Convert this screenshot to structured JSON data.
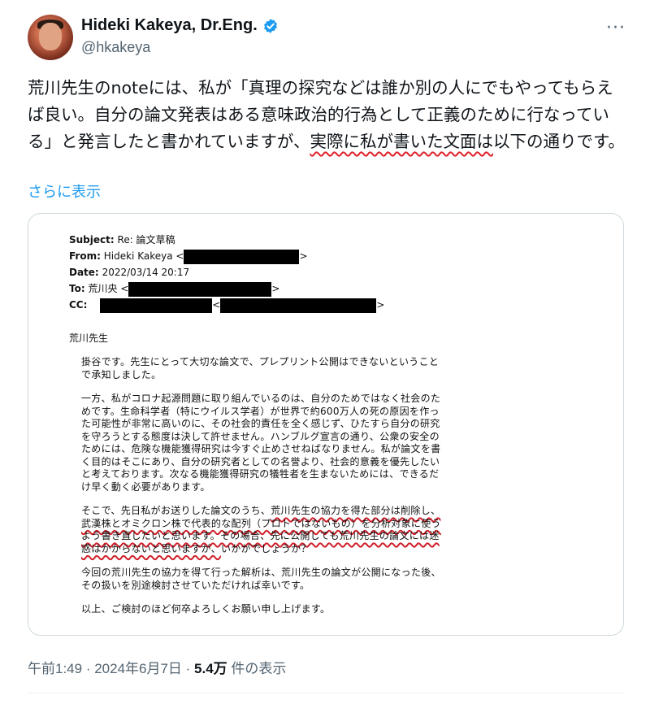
{
  "author": {
    "display_name": "Hideki Kakeya, Dr.Eng.",
    "handle": "@hkakeya",
    "verified_icon": "verified-badge-icon",
    "verified_color": "#1d9bf0"
  },
  "more_icon": "more-options-icon",
  "tweet": {
    "text_part1": "荒川先生のnoteには、私が「真理の探究などは誰か別の人にでもやってもらえば良い。自分の論文発表はある意味政治的行為として正義のために行なっている」と発言したと書かれていますが、",
    "text_underlined": "実際に私が書いた文面は",
    "text_part2": "以下の通りです。",
    "show_more": "さらに表示"
  },
  "email": {
    "subject_label": "Subject:",
    "subject": "Re: 論文草稿",
    "from_label": "From:",
    "from": "Hideki Kakeya <",
    "from_end": ">",
    "date_label": "Date:",
    "date": "2022/03/14 20:17",
    "to_label": "To:",
    "to": "荒川央 <",
    "to_end": ">",
    "cc_label": "CC:",
    "cc_mid": "<",
    "cc_end": ">",
    "greeting": "荒川先生",
    "p1": "掛谷です。先生にとって大切な論文で、プレプリント公開はできないということで承知しました。",
    "p2": "一方、私がコロナ起源問題に取り組んでいるのは、自分のためではなく社会のためです。生命科学者（特にウイルス学者）が世界で約600万人の死の原因を作った可能性が非常に高いのに、その社会的責任を全く感じず、ひたすら自分の研究を守ろうとする態度は決して許せません。ハンブルグ宣言の通り、公衆の安全のためには、危険な機能獲得研究は今すぐ止めさせねばなりません。私が論文を書く目的はそこにあり、自分の研究者としての名誉より、社会的意義を優先したいと考えております。次なる機能獲得研究の犠牲者を生まないためには、できるだけ早く動く必要があります。",
    "p3_a": "そこで、先日私がお送りした論文のうち、",
    "p3_u": "荒川先生の協力を得た部分は削除し、武漢株とオミクロン株で代表的な配列（プロトではないもの）を分析対象に使うよう書き直したいと思います。その場合、先に公開しても荒川先生の論文には迷惑はかからないと思いますが、",
    "p3_b": "いかがでしょうか？",
    "p4": "今回の荒川先生の協力を得て行った解析は、荒川先生の論文が公開になった後、その扱いを別途検討させていただければ幸いです。",
    "p5": "以上、ご検討のほど何卒よろしくお願い申し上げます。"
  },
  "meta": {
    "time": "午前1:49",
    "sep1": " · ",
    "date": "2024年6月7日",
    "sep2": " · ",
    "views": "5.4万",
    "views_label": " 件の表示"
  },
  "colors": {
    "link": "#1d9bf0",
    "secondary_text": "#536471",
    "underline_red": "#e0222a"
  }
}
